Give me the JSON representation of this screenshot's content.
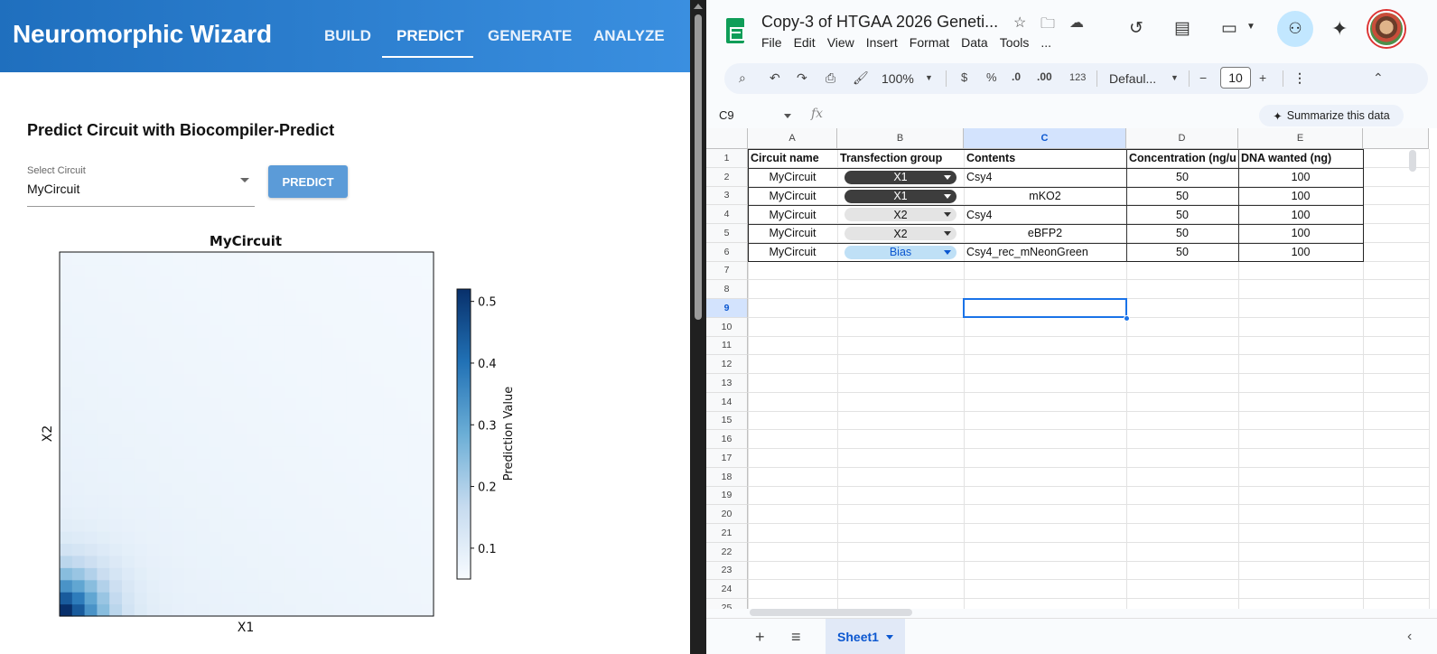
{
  "app": {
    "brand": "Neuromorphic Wizard",
    "nav": [
      {
        "label": "BUILD",
        "active": false
      },
      {
        "label": "PREDICT",
        "active": true
      },
      {
        "label": "GENERATE",
        "active": false
      },
      {
        "label": "ANALYZE",
        "active": false
      }
    ],
    "page_title": "Predict Circuit with Biocompiler-Predict",
    "select": {
      "label": "Select Circuit",
      "value": "MyCircuit"
    },
    "predict_button": "PREDICT"
  },
  "chart_data": {
    "type": "heatmap",
    "title": "MyCircuit",
    "xlabel": "X1",
    "ylabel": "X2",
    "colorbar_label": "Prediction Value",
    "colorbar_ticks": [
      0.1,
      0.2,
      0.3,
      0.4,
      0.5
    ],
    "value_range": [
      0.05,
      0.52
    ],
    "grid_size": 30,
    "colormap": "Blues"
  },
  "sheets": {
    "doc_title": "Copy-3 of HTGAA 2026 Geneti...",
    "menu": [
      "File",
      "Edit",
      "View",
      "Insert",
      "Format",
      "Data",
      "Tools",
      "..."
    ],
    "toolbar": {
      "zoom": "100%",
      "currency": "$",
      "percent": "%",
      "dec_decrease": ".0",
      "dec_increase": ".00",
      "number_format": "123",
      "font": "Defaul...",
      "font_size": "10"
    },
    "name_box": "C9",
    "fx": "fx",
    "summarize": "Summarize this data",
    "columns": [
      "A",
      "B",
      "C",
      "D",
      "E"
    ],
    "selected_column": "C",
    "selected_row": 9,
    "row_numbers": [
      1,
      2,
      3,
      4,
      5,
      6,
      7,
      8,
      9,
      10,
      11,
      12,
      13,
      14,
      15,
      16,
      17,
      18,
      19,
      20,
      21,
      22,
      23,
      24,
      25
    ],
    "headers": [
      "Circuit name",
      "Transfection group",
      "Contents",
      "Concentration (ng/u",
      "DNA wanted (ng)"
    ],
    "rows": [
      {
        "circuit": "MyCircuit",
        "group": "X1",
        "group_style": "dark",
        "contents": "Csy4",
        "contents_align": "left",
        "concentration": "50",
        "dna": "100"
      },
      {
        "circuit": "MyCircuit",
        "group": "X1",
        "group_style": "dark",
        "contents": "mKO2",
        "contents_align": "center",
        "concentration": "50",
        "dna": "100"
      },
      {
        "circuit": "MyCircuit",
        "group": "X2",
        "group_style": "light",
        "contents": "Csy4",
        "contents_align": "left",
        "concentration": "50",
        "dna": "100"
      },
      {
        "circuit": "MyCircuit",
        "group": "X2",
        "group_style": "light",
        "contents": "eBFP2",
        "contents_align": "center",
        "concentration": "50",
        "dna": "100"
      },
      {
        "circuit": "MyCircuit",
        "group": "Bias",
        "group_style": "blue",
        "contents": "Csy4_rec_mNeonGreen",
        "contents_align": "left",
        "concentration": "50",
        "dna": "100"
      }
    ],
    "sheet_tab": "Sheet1"
  },
  "colors": {
    "appbar_start": "#1f6fbe",
    "appbar_end": "#3a8fe0",
    "predict_button": "#5b9bd8",
    "chip_dark": "#3d3d3d",
    "chip_light": "#e4e4e4",
    "chip_blue": "#bfe0f6",
    "selection": "#1a73e8"
  }
}
